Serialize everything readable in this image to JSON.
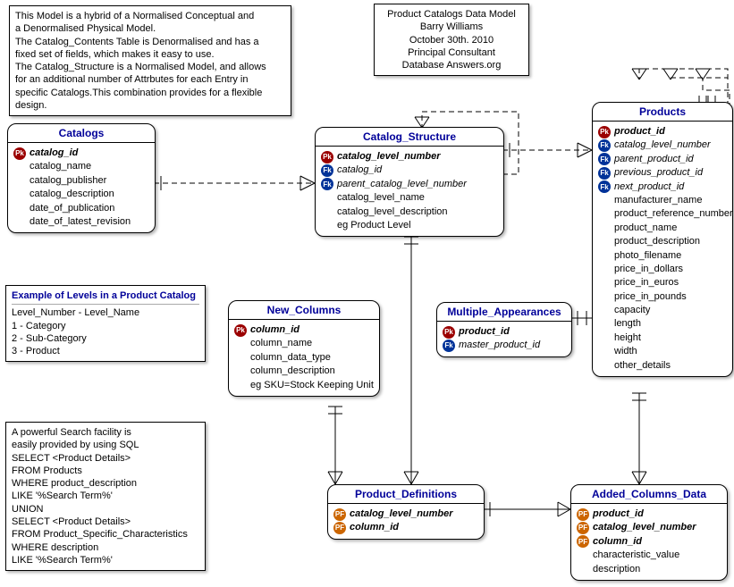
{
  "notes": {
    "explain": {
      "lines": [
        "This Model is a hybrid of a Normalised Conceptual and",
        "a Denormalised Physical Model.",
        "The Catalog_Contents Table is Denormalised and has a",
        "fixed set of fields,  which makes it easy to use.",
        "The Catalog_Structure is a Normalised Model, and allows",
        "for an additional number of  Attrbutes for each Entry in",
        "specific Catalogs.This combination provides for a flexible design."
      ]
    },
    "header": {
      "lines": [
        "Product Catalogs Data Model",
        "Barry Williams",
        "October 30th. 2010",
        "Principal Consultant",
        "Database Answers.org"
      ]
    },
    "levels": {
      "title": "Example of Levels in a Product Catalog",
      "lines": [
        "Level_Number - Level_Name",
        "1 - Category",
        "2 - Sub-Category",
        "3 - Product"
      ]
    },
    "search": {
      "lines": [
        "A powerful Search facility is",
        "easily provided by using SQL",
        "SELECT <Product Details>",
        "FROM    Products",
        "WHERE  product_description",
        "LIKE '%Search Term%'",
        "UNION",
        "SELECT <Product Details>",
        " FROM   Product_Specific_Characteristics",
        "WHERE  description",
        "LIKE '%Search Term%'"
      ]
    }
  },
  "entities": {
    "catalogs": {
      "title": "Catalogs",
      "attrs": [
        {
          "key": "pk",
          "name": "catalog_id"
        },
        {
          "key": "",
          "name": "catalog_name"
        },
        {
          "key": "",
          "name": "catalog_publisher"
        },
        {
          "key": "",
          "name": "catalog_description"
        },
        {
          "key": "",
          "name": "date_of_publication"
        },
        {
          "key": "",
          "name": "date_of_latest_revision"
        }
      ]
    },
    "catalog_structure": {
      "title": "Catalog_Structure",
      "attrs": [
        {
          "key": "pk",
          "name": "catalog_level_number"
        },
        {
          "key": "fk",
          "name": "catalog_id"
        },
        {
          "key": "fk",
          "name": "parent_catalog_level_number"
        },
        {
          "key": "",
          "name": "catalog_level_name"
        },
        {
          "key": "",
          "name": "catalog_level_description"
        },
        {
          "key": "",
          "name": "eg Product Level"
        }
      ]
    },
    "products": {
      "title": "Products",
      "attrs": [
        {
          "key": "pk",
          "name": "product_id"
        },
        {
          "key": "fk",
          "name": "catalog_level_number"
        },
        {
          "key": "fk",
          "name": "parent_product_id"
        },
        {
          "key": "fk",
          "name": "previous_product_id"
        },
        {
          "key": "fk",
          "name": "next_product_id"
        },
        {
          "key": "",
          "name": "manufacturer_name"
        },
        {
          "key": "",
          "name": "product_reference_number"
        },
        {
          "key": "",
          "name": "product_name"
        },
        {
          "key": "",
          "name": "product_description"
        },
        {
          "key": "",
          "name": "photo_filename"
        },
        {
          "key": "",
          "name": "price_in_dollars"
        },
        {
          "key": "",
          "name": "price_in_euros"
        },
        {
          "key": "",
          "name": "price_in_pounds"
        },
        {
          "key": "",
          "name": "capacity"
        },
        {
          "key": "",
          "name": "length"
        },
        {
          "key": "",
          "name": "height"
        },
        {
          "key": "",
          "name": "width"
        },
        {
          "key": "",
          "name": "other_details"
        }
      ]
    },
    "new_columns": {
      "title": "New_Columns",
      "attrs": [
        {
          "key": "pk",
          "name": "column_id"
        },
        {
          "key": "",
          "name": "column_name"
        },
        {
          "key": "",
          "name": "column_data_type"
        },
        {
          "key": "",
          "name": "column_description"
        },
        {
          "key": "",
          "name": "eg SKU=Stock Keeping Unit"
        }
      ]
    },
    "multiple_appearances": {
      "title": "Multiple_Appearances",
      "attrs": [
        {
          "key": "pk",
          "name": "product_id"
        },
        {
          "key": "fk",
          "name": "master_product_id"
        }
      ]
    },
    "product_definitions": {
      "title": "Product_Definitions",
      "attrs": [
        {
          "key": "pf",
          "name": "catalog_level_number"
        },
        {
          "key": "pf",
          "name": "column_id"
        }
      ]
    },
    "added_columns_data": {
      "title": "Added_Columns_Data",
      "attrs": [
        {
          "key": "pf",
          "name": "product_id"
        },
        {
          "key": "pf",
          "name": "catalog_level_number"
        },
        {
          "key": "pf",
          "name": "column_id"
        },
        {
          "key": "",
          "name": "characteristic_value"
        },
        {
          "key": "",
          "name": "description"
        }
      ]
    }
  },
  "badges": {
    "pk": "Pk",
    "fk": "Fk",
    "pf": "PF"
  }
}
